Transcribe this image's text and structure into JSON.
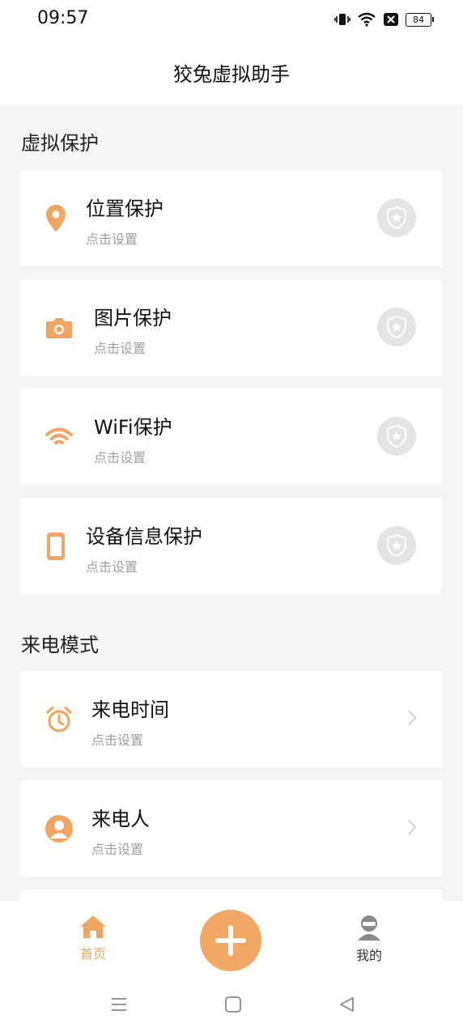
{
  "status": {
    "time": "09:57",
    "battery": "84"
  },
  "header": {
    "title": "狡兔虚拟助手"
  },
  "sections": {
    "protect": "虚拟保护",
    "call": "来电模式"
  },
  "protect_items": [
    {
      "label": "位置保护",
      "sub": "点击设置",
      "icon": "location-pin-icon"
    },
    {
      "label": "图片保护",
      "sub": "点击设置",
      "icon": "camera-icon"
    },
    {
      "label": "WiFi保护",
      "sub": "点击设置",
      "icon": "wifi-icon"
    },
    {
      "label": "设备信息保护",
      "sub": "点击设置",
      "icon": "phone-device-icon"
    }
  ],
  "call_items": [
    {
      "label": "来电时间",
      "sub": "点击设置",
      "icon": "alarm-clock-icon"
    },
    {
      "label": "来电人",
      "sub": "点击设置",
      "icon": "person-icon"
    }
  ],
  "bottom_nav": {
    "home": "首页",
    "mine": "我的"
  },
  "colors": {
    "accent": "#f2a865",
    "icon": "#f0a560"
  }
}
